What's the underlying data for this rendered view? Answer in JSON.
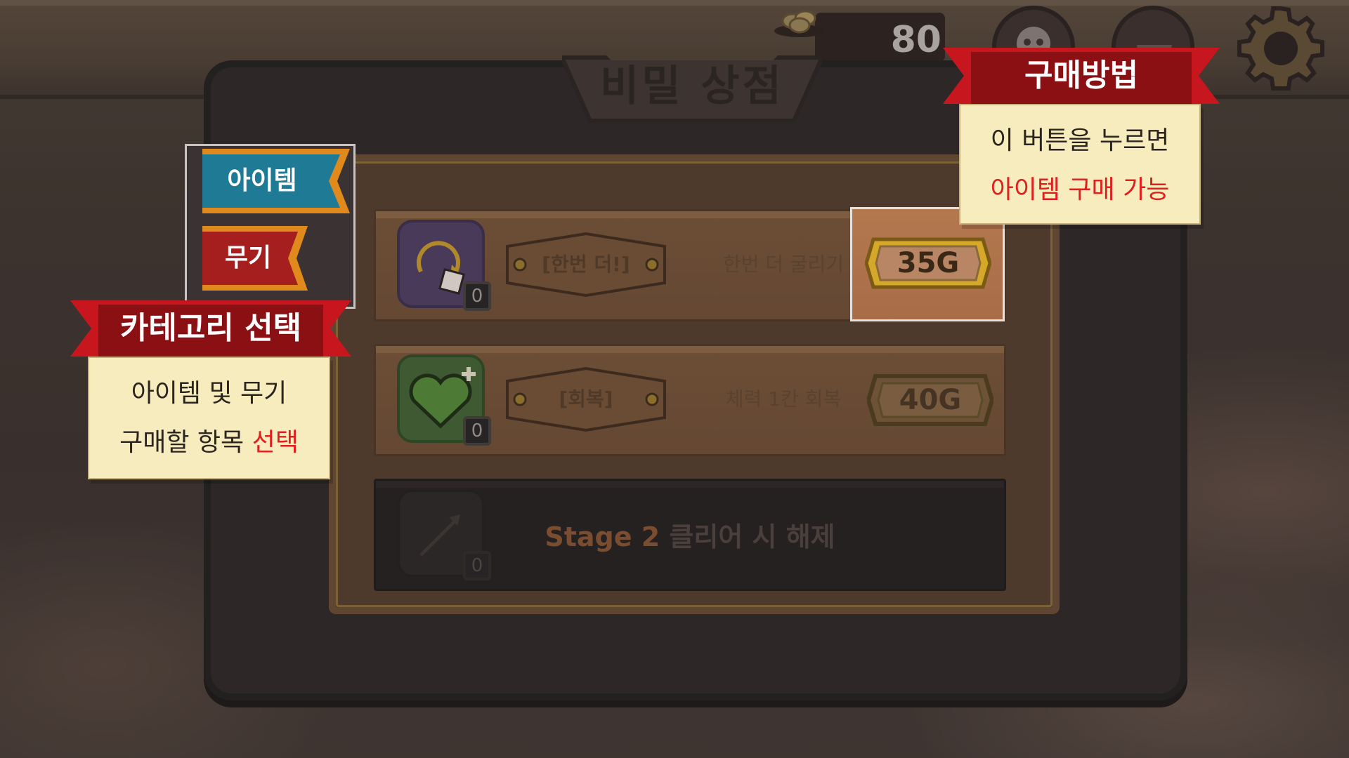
{
  "hud": {
    "coin_count": "80"
  },
  "shop": {
    "title": "비밀 상점",
    "tabs": [
      {
        "label": "아이템",
        "color": "#1f7a96"
      },
      {
        "label": "무기",
        "color": "#a51f1f"
      }
    ],
    "items": [
      {
        "name": "[한번 더!]",
        "description": "한번 더 굴리기",
        "price": "35G",
        "count": "0"
      },
      {
        "name": "[회복]",
        "description": "체력 1칸 회복",
        "price": "40G",
        "count": "0"
      },
      {
        "locked_stage": "Stage 2",
        "locked_text": "클리어 시 해제",
        "count": "0"
      }
    ]
  },
  "tooltips": {
    "purchase": {
      "header": "구매방법",
      "line1": "이 버튼을 누르면",
      "line2": "아이템 구매 가능"
    },
    "category": {
      "header": "카테고리 선택",
      "line1": "아이템 및 무기",
      "line2_prefix": "구매할 항목 ",
      "line2_highlight": "선택"
    }
  },
  "colors": {
    "ribbon_red": "#c8161e",
    "note_bg": "#f7ecbd",
    "highlight_text": "#e01f1f"
  }
}
